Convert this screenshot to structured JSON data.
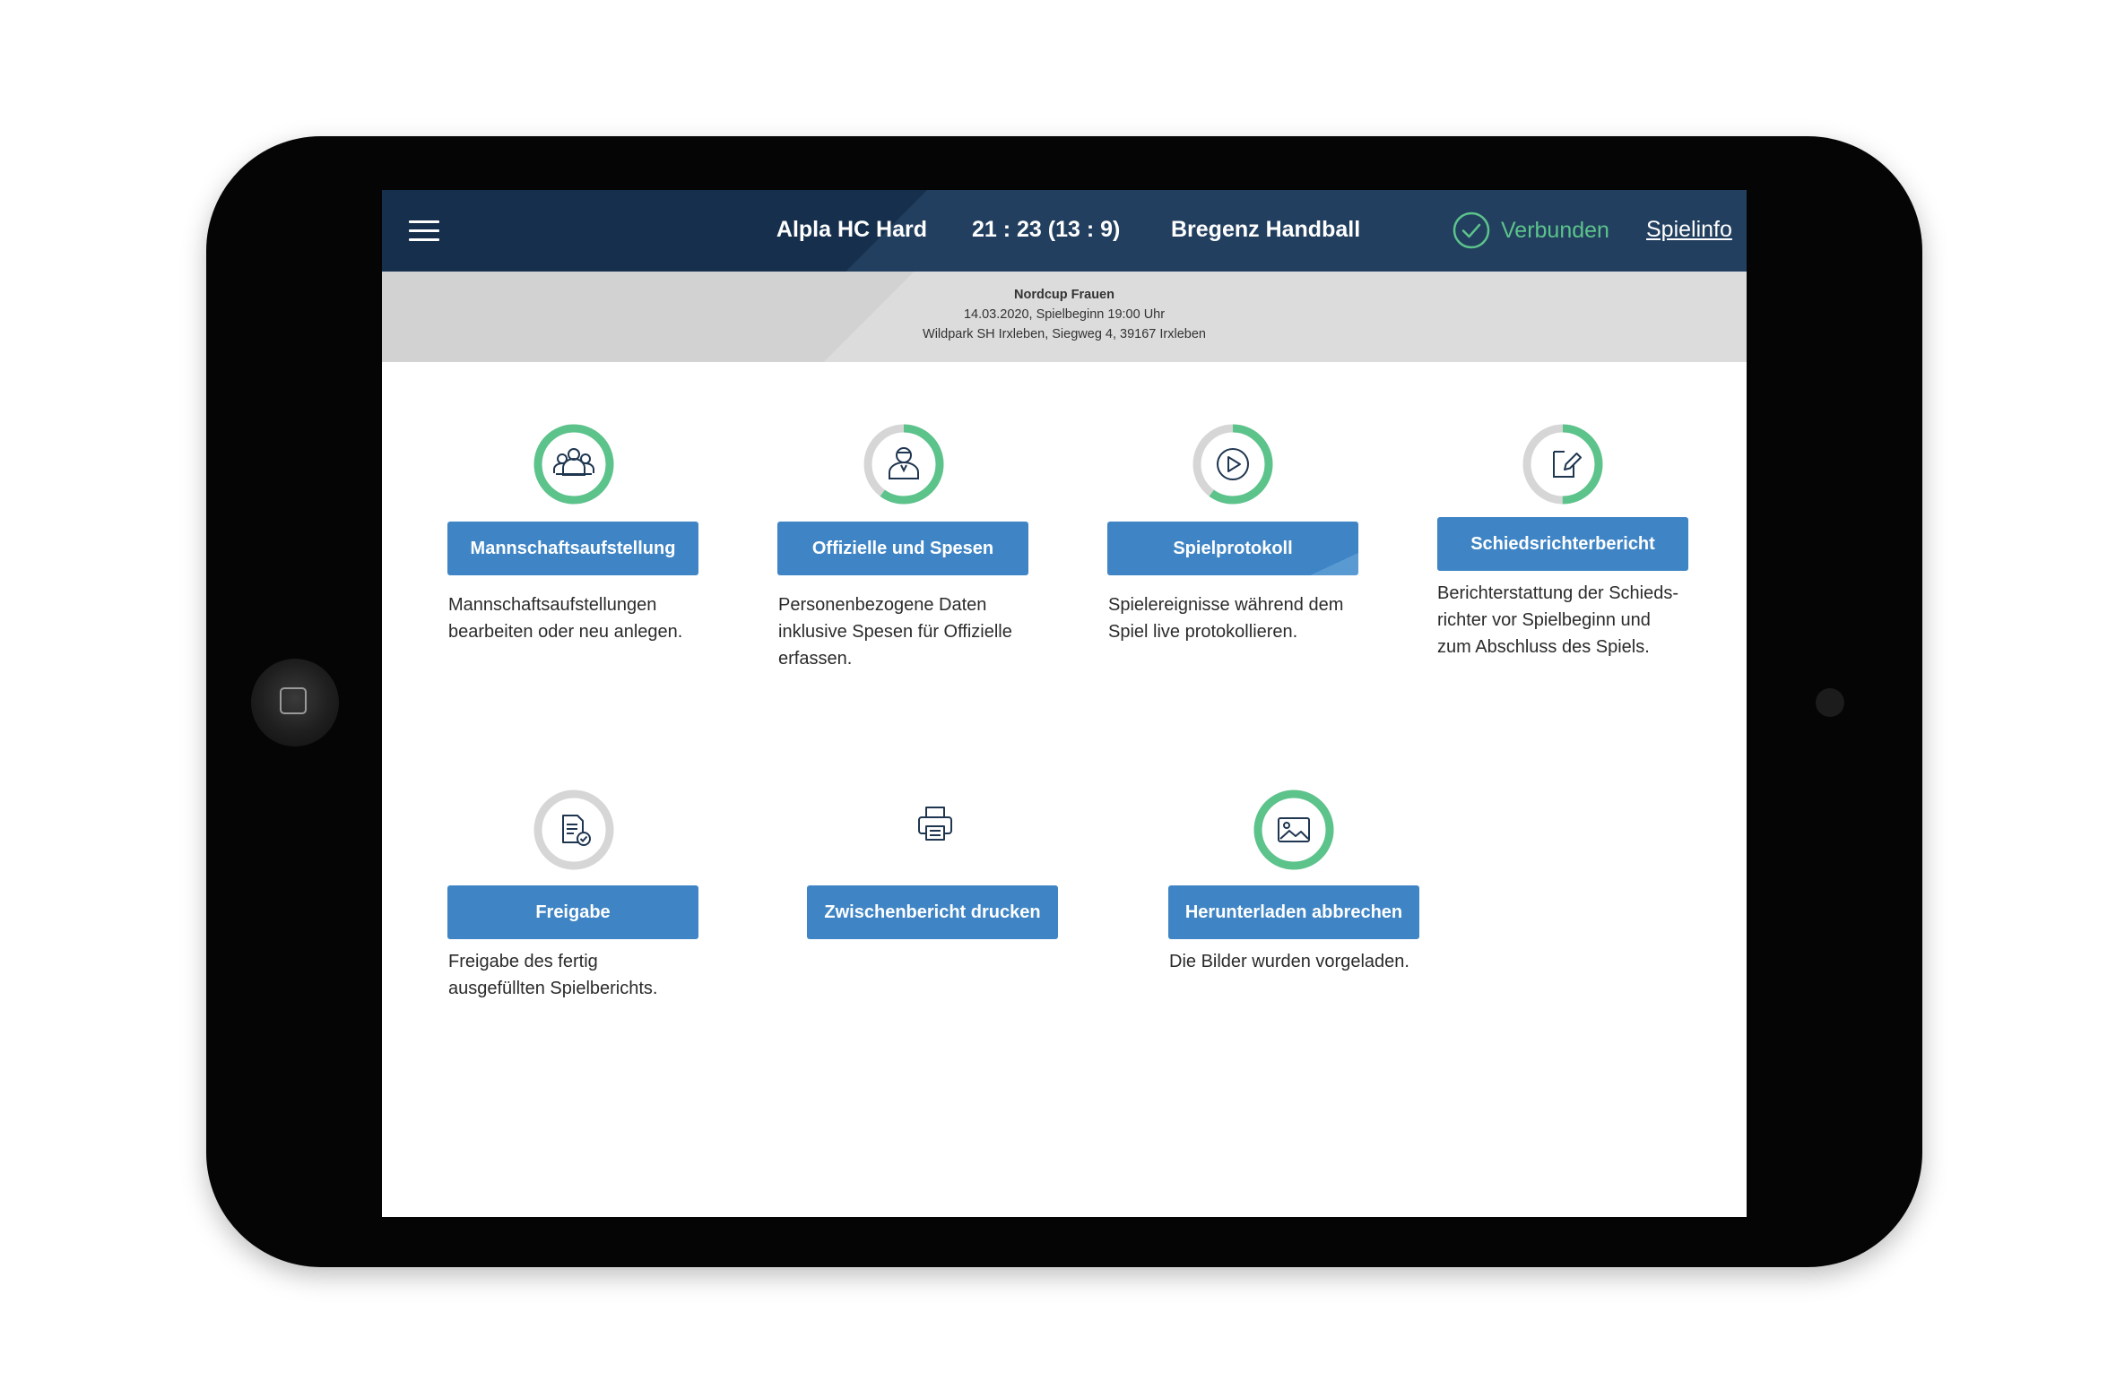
{
  "header": {
    "home_team": "Alpla HC Hard",
    "score": "21 : 23 (13 : 9)",
    "away_team": "Bregenz Handball",
    "status": "Verbunden",
    "info_link": "Spielinfo"
  },
  "match_info": {
    "competition": "Nordcup Frauen",
    "date_line": "14.03.2020, Spielbeginn 19:00 Uhr",
    "venue": "Wildpark SH Irxleben, Siegweg 4, 39167 Irxleben"
  },
  "tiles": [
    {
      "label": "Mannschaftsaufstellung",
      "desc_lines": [
        "Mannschaftsaufstellungen",
        "bearbeiten oder neu anlegen."
      ],
      "icon": "team-icon",
      "progress": 1.0
    },
    {
      "label": "Offizielle und Spesen",
      "desc_lines": [
        "Personenbezogene Daten",
        "inklusive Spesen für Offizielle",
        "erfassen."
      ],
      "icon": "official-person-icon",
      "progress": 0.6
    },
    {
      "label": "Spielprotokoll",
      "desc_lines": [
        "Spielereignisse während dem",
        "Spiel live protokollieren."
      ],
      "icon": "play-icon",
      "progress": 0.6
    },
    {
      "label": "Schiedsrichterbericht",
      "desc_lines": [
        "Berichterstattung der Schieds-",
        "richter vor Spielbeginn und",
        "zum Abschluss des Spiels."
      ],
      "icon": "edit-document-icon",
      "progress": 0.5
    },
    {
      "label": "Freigabe",
      "desc_lines": [
        "Freigabe des fertig",
        "ausgefüllten Spielberichts."
      ],
      "icon": "document-approve-icon",
      "progress": 0.0
    },
    {
      "label": "Zwischenbericht drucken",
      "desc_lines": [],
      "icon": "printer-icon",
      "progress": null
    },
    {
      "label": "Herunterladen abbrechen",
      "desc_lines": [
        "Die Bilder wurden vorgeladen."
      ],
      "icon": "image-icon",
      "progress": 1.0
    }
  ],
  "colors": {
    "header_dark": "#162f4d",
    "header_light": "#223f5f",
    "accent_green": "#5cc38b",
    "button_blue": "#3f85c5",
    "ring_gray": "#d6d6d6",
    "icon_navy": "#1f3651"
  }
}
